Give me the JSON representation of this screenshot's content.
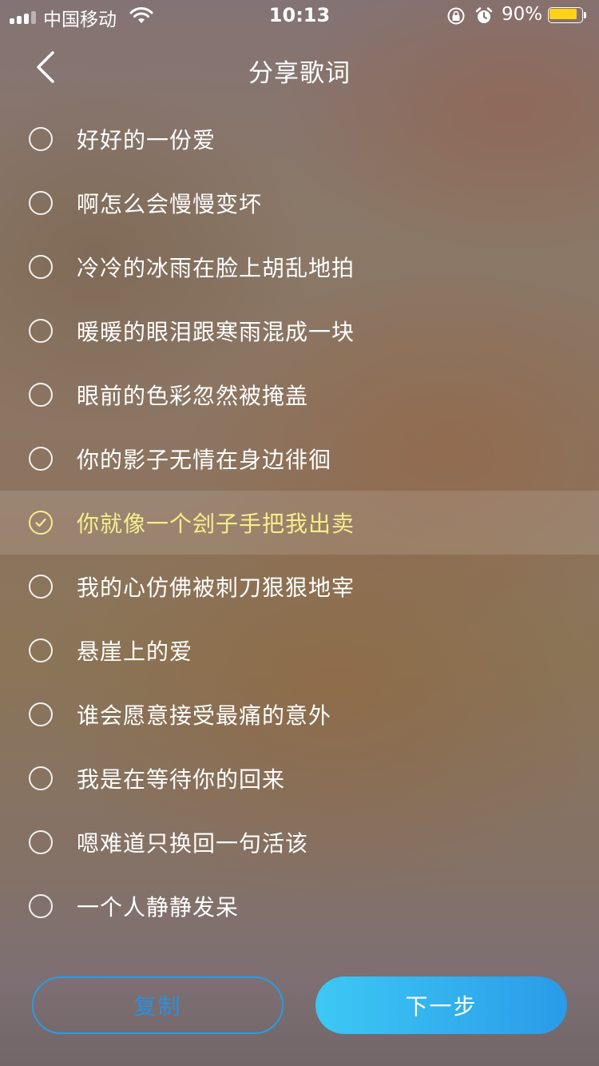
{
  "status_bar": {
    "carrier": "中国移动",
    "time": "10:13",
    "battery_percent": "90%",
    "battery_level": 0.9,
    "battery_color": "#ffd21a"
  },
  "header": {
    "title": "分享歌词",
    "back_icon": "chevron-left-icon"
  },
  "lyrics": [
    {
      "text": "好好的一份爱",
      "selected": false
    },
    {
      "text": "啊怎么会慢慢变坏",
      "selected": false
    },
    {
      "text": "冷冷的冰雨在脸上胡乱地拍",
      "selected": false
    },
    {
      "text": "暖暖的眼泪跟寒雨混成一块",
      "selected": false
    },
    {
      "text": "眼前的色彩忽然被掩盖",
      "selected": false
    },
    {
      "text": "你的影子无情在身边徘徊",
      "selected": false
    },
    {
      "text": "你就像一个刽子手把我出卖",
      "selected": true
    },
    {
      "text": "我的心仿佛被刺刀狠狠地宰",
      "selected": false
    },
    {
      "text": "悬崖上的爱",
      "selected": false
    },
    {
      "text": "谁会愿意接受最痛的意外",
      "selected": false
    },
    {
      "text": "我是在等待你的回来",
      "selected": false
    },
    {
      "text": "嗯难道只换回一句活该",
      "selected": false
    },
    {
      "text": "一个人静静发呆",
      "selected": false
    }
  ],
  "actions": {
    "copy_label": "复制",
    "next_label": "下一步"
  },
  "colors": {
    "selected_text": "#f6ee8a",
    "accent_blue": "#2a9be6",
    "next_gradient_start": "#3dc8f4",
    "next_gradient_end": "#2a9be8"
  }
}
